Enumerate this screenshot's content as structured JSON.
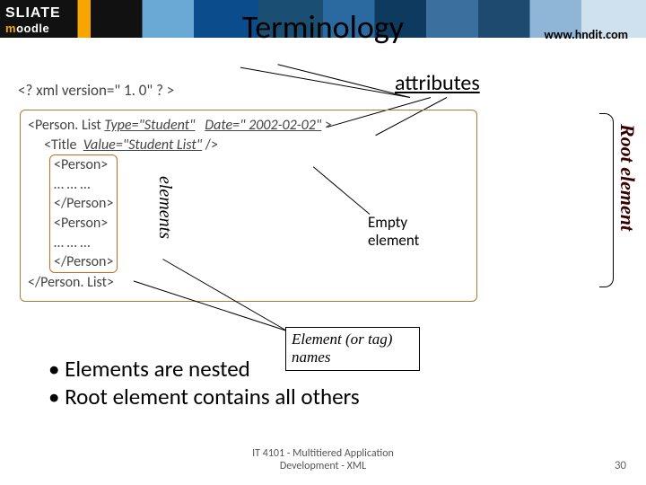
{
  "header": {
    "logo_top": "SLIATE",
    "logo_bottom_html": "moodle",
    "title": "Terminology",
    "url": "www.hndit.com"
  },
  "labels": {
    "attributes": "attributes",
    "elements": "elements",
    "root_element": "Root element",
    "empty_l1": "Empty",
    "empty_l2": "element",
    "elname_l1": "Element (or tag)",
    "elname_l2": "names"
  },
  "code": {
    "decl": "<? xml  version=\" 1. 0\" ? >",
    "l1a": "<Person. List ",
    "l1b": "Type=\"Student\"",
    "l1c": "   ",
    "l1d": "Date=\" 2002-02-02\"",
    "l1e": " >",
    "l2a": "     <Title  ",
    "l2b": "Value=\"Student List\"",
    "l2c": " />",
    "p_open": "<Person>",
    "p_dots": "… … …",
    "p_close": "</Person>",
    "list_close": "</Person. List>"
  },
  "bullets": {
    "b1": "Elements are nested",
    "b2": "Root element contains all others"
  },
  "footer": {
    "f1": "IT 4101 - Multitiered Application",
    "f2": "Development - XML",
    "page": "30"
  }
}
